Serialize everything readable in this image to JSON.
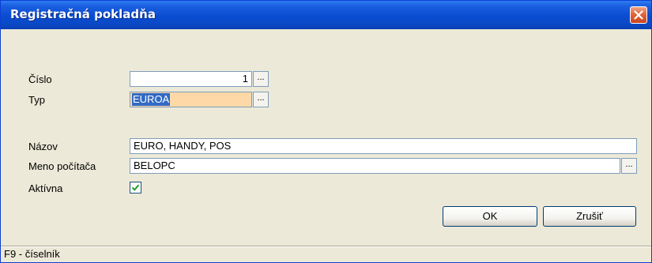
{
  "window": {
    "title": "Registračná pokladňa"
  },
  "form": {
    "cislo": {
      "label": "Číslo",
      "value": "1"
    },
    "typ": {
      "label": "Typ",
      "value": "EUROA"
    },
    "nazov": {
      "label": "Názov",
      "value": "EURO, HANDY, POS"
    },
    "meno_pocitaca": {
      "label": "Meno počítača",
      "value": "BELOPC"
    },
    "aktivna": {
      "label": "Aktívna",
      "checked": true
    },
    "browse_glyph": "..."
  },
  "buttons": {
    "ok": "OK",
    "cancel": "Zrušiť"
  },
  "status": {
    "text": "F9 - číselník"
  },
  "colors": {
    "titlebar": "#0a4cd2",
    "focus_field": "#ffd8a8",
    "selection": "#316ac5",
    "dialog_bg": "#ece9d8",
    "check": "#21a121"
  },
  "icons": {
    "close": "close-icon",
    "check": "checkmark-icon"
  }
}
